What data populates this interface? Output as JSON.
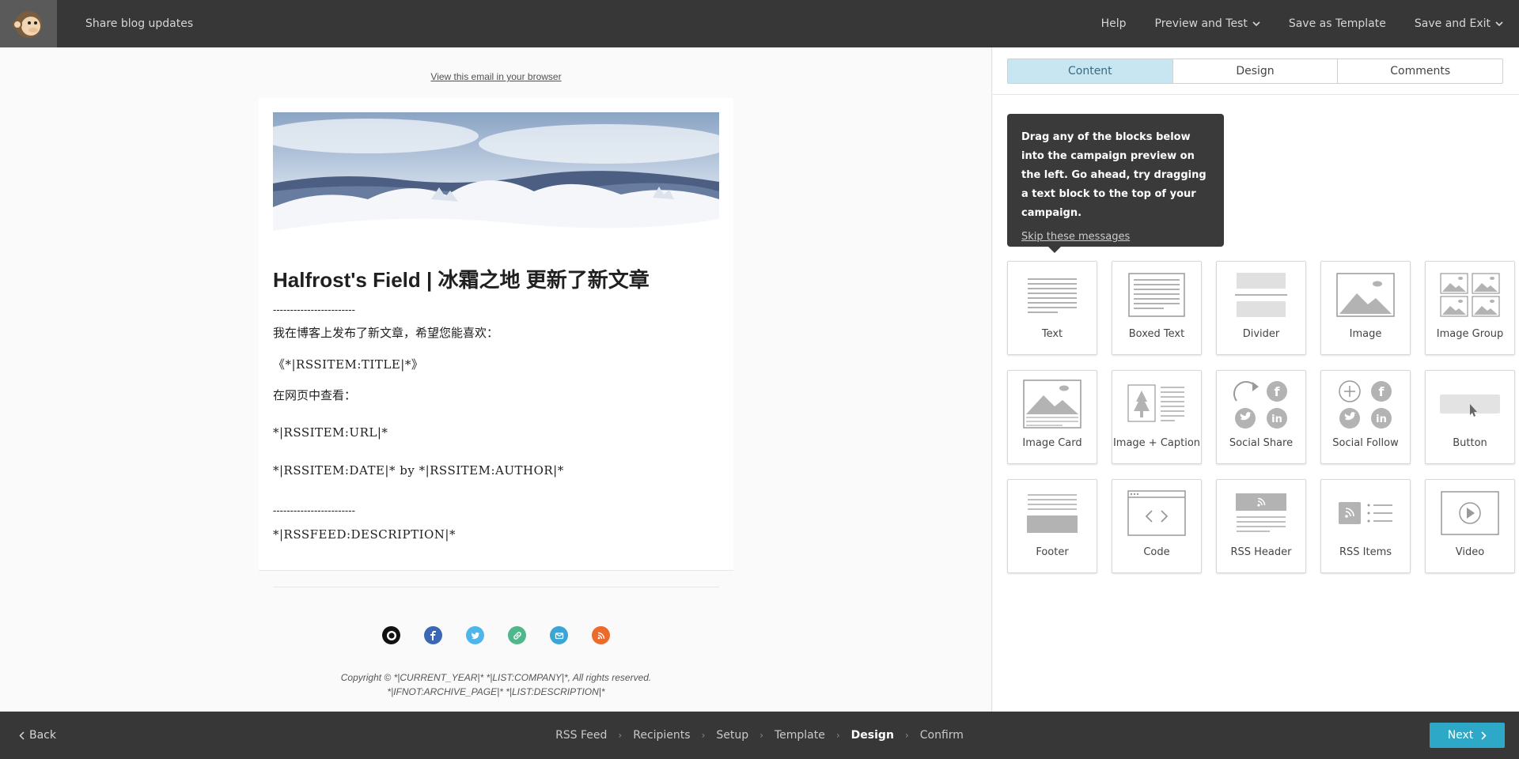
{
  "header": {
    "campaign_title": "Share blog updates",
    "help": "Help",
    "preview_test": "Preview and Test",
    "save_template": "Save as Template",
    "save_exit": "Save and Exit"
  },
  "preview": {
    "view_in_browser": "View this email in your browser",
    "title": "Halfrost's Field | 冰霜之地 更新了新文章",
    "dashes": "------------------------",
    "intro": "我在博客上发布了新文章，希望您能喜欢：",
    "item_title": "《*|RSSITEM:TITLE|*》",
    "view_on_web": "在网页中查看：",
    "item_url": "*|RSSITEM:URL|*",
    "item_date": "*|RSSITEM:DATE|* by *|RSSITEM:AUTHOR|*",
    "feed_desc": "*|RSSFEED:DESCRIPTION|*",
    "copyright_line1": "Copyright © *|CURRENT_YEAR|* *|LIST:COMPANY|*, All rights reserved.",
    "copyright_line2": "*|IFNOT:ARCHIVE_PAGE|* *|LIST:DESCRIPTION|*",
    "social_icons": [
      "github-icon",
      "facebook-icon",
      "twitter-icon",
      "link-icon",
      "email-icon",
      "rss-icon"
    ]
  },
  "panel": {
    "tabs": [
      "Content",
      "Design",
      "Comments"
    ],
    "active_tab": "Content",
    "tooltip_text": "Drag any of the blocks below into the campaign preview on the left. Go ahead, try dragging a text block to the top of your campaign.",
    "tooltip_skip": "Skip these messages",
    "blocks": [
      "Text",
      "Boxed Text",
      "Divider",
      "Image",
      "Image Group",
      "Image Card",
      "Image + Caption",
      "Social Share",
      "Social Follow",
      "Button",
      "Footer",
      "Code",
      "RSS Header",
      "RSS Items",
      "Video"
    ]
  },
  "footer": {
    "back": "Back",
    "steps": [
      "RSS Feed",
      "Recipients",
      "Setup",
      "Template",
      "Design",
      "Confirm"
    ],
    "current_step": "Design",
    "next": "Next"
  },
  "colors": {
    "topbar": "#373737",
    "accent": "#2ea8c7",
    "active_tab": "#c7e6f1",
    "icon_gray": "#b3b3b3"
  }
}
